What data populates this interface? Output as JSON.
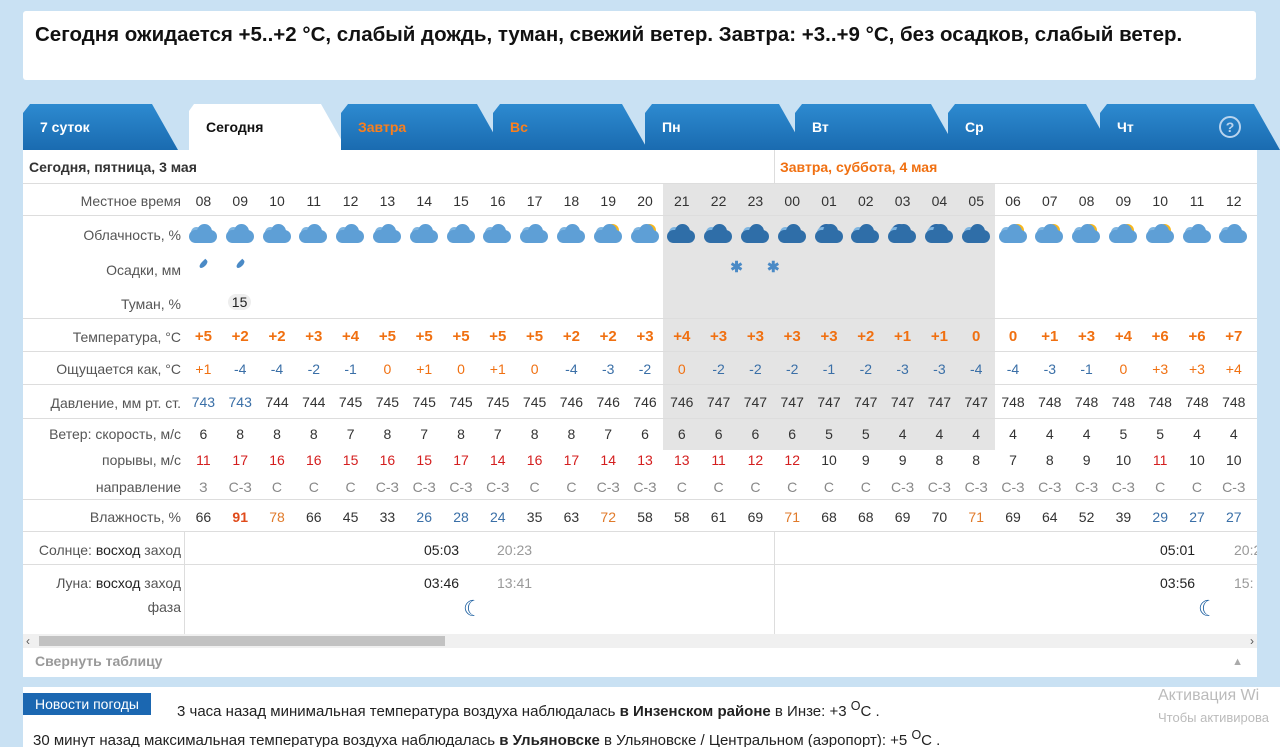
{
  "summary": "Сегодня ожидается +5..+2 °C, слабый дождь, туман, свежий ветер. Завтра: +3..+9 °C, без осадков, слабый ветер.",
  "tabs": [
    {
      "label": "7 суток",
      "style": "normal"
    },
    {
      "label": "Сегодня",
      "style": "active"
    },
    {
      "label": "Завтра",
      "style": "orange"
    },
    {
      "label": "Вс",
      "style": "orange"
    },
    {
      "label": "Пн",
      "style": "normal"
    },
    {
      "label": "Вт",
      "style": "normal"
    },
    {
      "label": "Ср",
      "style": "normal"
    },
    {
      "label": "Чт",
      "style": "normal"
    }
  ],
  "help_icon": "?",
  "dates": {
    "today": "Сегодня, пятница, 3 мая",
    "tomorrow": "Завтра, суббота, 4 мая"
  },
  "labels": {
    "time": "Местное время",
    "cloud": "Облачность, %",
    "precip": "Осадки, мм",
    "fog": "Туман, %",
    "temp": "Температура, °C",
    "feels": "Ощущается как, °C",
    "pressure": "Давление, мм рт. ст.",
    "wind_speed": "Ветер: скорость, м/с",
    "gusts": "порывы, м/с",
    "direction": "направление",
    "humidity": "Влажность, %",
    "sun_prefix": "Солнце:",
    "rise": "восход",
    "set": "заход",
    "moon_prefix": "Луна:",
    "phase": "фаза"
  },
  "hours": [
    "08",
    "09",
    "10",
    "11",
    "12",
    "13",
    "14",
    "15",
    "16",
    "17",
    "18",
    "19",
    "20",
    "21",
    "22",
    "23",
    "00",
    "01",
    "02",
    "03",
    "04",
    "05",
    "06",
    "07",
    "08",
    "09",
    "10",
    "11",
    "12"
  ],
  "cloud_icons": [
    "cloudy",
    "cloudy",
    "cloudy",
    "cloudy",
    "cloudy",
    "cloudy",
    "cloudy",
    "cloudy",
    "cloudy",
    "cloudy",
    "cloudy",
    "partly-sun",
    "partly-sun",
    "night-cloud",
    "night-cloud",
    "night-cloud",
    "night-cloud",
    "night-moon",
    "night-cloud",
    "night-moon",
    "night-moon",
    "night-cloud",
    "partly-sun",
    "partly-sun",
    "sun-cloud",
    "sun-cloud",
    "partly-sun",
    "cloudy",
    "cloudy"
  ],
  "precip": {
    "rain_hours": [
      "08",
      "09"
    ],
    "snow_hours": [
      "22",
      "23"
    ]
  },
  "fog": {
    "hour": "09",
    "value": "15"
  },
  "temperature": [
    "+5",
    "+2",
    "+2",
    "+3",
    "+4",
    "+5",
    "+5",
    "+5",
    "+5",
    "+5",
    "+2",
    "+2",
    "+3",
    "+4",
    "+3",
    "+3",
    "+3",
    "+3",
    "+2",
    "+1",
    "+1",
    "0",
    "0",
    "+1",
    "+3",
    "+4",
    "+6",
    "+6",
    "+7"
  ],
  "feels_like": [
    "+1",
    "-4",
    "-4",
    "-2",
    "-1",
    "0",
    "+1",
    "0",
    "+1",
    "0",
    "-4",
    "-3",
    "-2",
    "0",
    "-2",
    "-2",
    "-2",
    "-1",
    "-2",
    "-3",
    "-3",
    "-4",
    "-4",
    "-3",
    "-1",
    "0",
    "+3",
    "+3",
    "+4"
  ],
  "pressure": [
    "743",
    "743",
    "744",
    "744",
    "745",
    "745",
    "745",
    "745",
    "745",
    "745",
    "746",
    "746",
    "746",
    "746",
    "747",
    "747",
    "747",
    "747",
    "747",
    "747",
    "747",
    "747",
    "748",
    "748",
    "748",
    "748",
    "748",
    "748",
    "748"
  ],
  "wind_speed": [
    "6",
    "8",
    "8",
    "8",
    "7",
    "8",
    "7",
    "8",
    "7",
    "8",
    "8",
    "7",
    "6",
    "6",
    "6",
    "6",
    "6",
    "5",
    "5",
    "4",
    "4",
    "4",
    "4",
    "4",
    "4",
    "5",
    "5",
    "4",
    "4"
  ],
  "gusts": [
    "11",
    "17",
    "16",
    "16",
    "15",
    "16",
    "15",
    "17",
    "14",
    "16",
    "17",
    "14",
    "13",
    "13",
    "11",
    "12",
    "12",
    "10",
    "9",
    "9",
    "8",
    "8",
    "7",
    "8",
    "9",
    "10",
    "11",
    "10",
    "10"
  ],
  "direction": [
    "З",
    "С-З",
    "С",
    "С",
    "С",
    "С-З",
    "С-З",
    "С-З",
    "С-З",
    "С",
    "С",
    "С-З",
    "С-З",
    "С",
    "С",
    "С",
    "С",
    "С",
    "С",
    "С-З",
    "С-З",
    "С-З",
    "С-З",
    "С-З",
    "С-З",
    "С-З",
    "С",
    "С",
    "С-З"
  ],
  "humidity": [
    "66",
    "91",
    "78",
    "66",
    "45",
    "33",
    "26",
    "28",
    "24",
    "35",
    "63",
    "72",
    "58",
    "58",
    "61",
    "69",
    "71",
    "68",
    "68",
    "69",
    "70",
    "71",
    "69",
    "64",
    "52",
    "39",
    "29",
    "27",
    "27"
  ],
  "sun": {
    "today_rise": "05:03",
    "today_set": "20:23",
    "tomorrow_rise": "05:01",
    "tomorrow_set": "20:2"
  },
  "moon": {
    "today_rise": "03:46",
    "today_set": "13:41",
    "tomorrow_rise": "03:56",
    "tomorrow_set": "15:"
  },
  "collapse": "Свернуть таблицу",
  "news": {
    "tag": "Новости погоды",
    "line1_a": "3 часа назад минимальная температура воздуха наблюдалась ",
    "line1_b": "в Инзенском районе",
    "line1_c": " в Инзе: +3 ",
    "line1_unit": "O",
    "line1_d": "C .",
    "line2_a": "30 минут назад максимальная температура воздуха наблюдалась ",
    "line2_b": "в Ульяновске",
    "line2_c": " в Ульяновске / Центральном (аэропорт): +5 ",
    "line2_unit": "O",
    "line2_d": "C ."
  },
  "watermark": {
    "line1": "Активация Wi",
    "line2": "Чтобы активирова"
  }
}
